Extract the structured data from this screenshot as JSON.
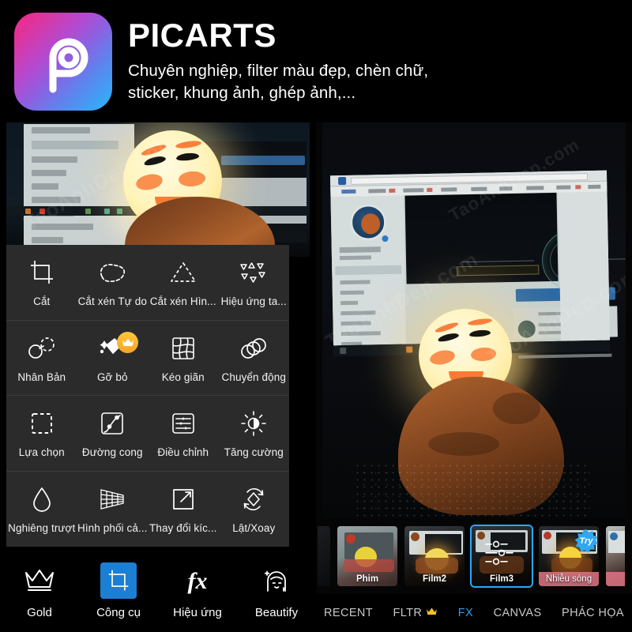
{
  "header": {
    "brand": "PICARTS",
    "tagline_line1": "Chuyên nghiệp, filter màu đẹp, chèn chữ,",
    "tagline_line2": "sticker, khung ảnh, ghép ảnh,...",
    "logo_icon": "picsart-logo-icon",
    "logo_gradient_start": "#f5268e",
    "logo_gradient_end": "#27b8fb"
  },
  "watermark": "TaoAnhDep.com",
  "tools_panel": {
    "rows": [
      [
        {
          "label": "Cắt",
          "icon": "crop-icon",
          "premium": false
        },
        {
          "label": "Cắt xén Tự do",
          "icon": "free-crop-icon",
          "premium": false
        },
        {
          "label": "Cắt xén Hìn...",
          "icon": "shape-crop-icon",
          "premium": false
        },
        {
          "label": "Hiệu ứng ta...",
          "icon": "dispersion-icon",
          "premium": false
        }
      ],
      [
        {
          "label": "Nhân Bản",
          "icon": "clone-icon",
          "premium": false
        },
        {
          "label": "Gỡ bỏ",
          "icon": "remove-icon",
          "premium": true
        },
        {
          "label": "Kéo giãn",
          "icon": "stretch-icon",
          "premium": false
        },
        {
          "label": "Chuyển động",
          "icon": "motion-icon",
          "premium": false
        }
      ],
      [
        {
          "label": "Lựa chọn",
          "icon": "selection-icon",
          "premium": false
        },
        {
          "label": "Đường cong",
          "icon": "curves-icon",
          "premium": false
        },
        {
          "label": "Điều chỉnh",
          "icon": "adjust-icon",
          "premium": false
        },
        {
          "label": "Tăng cường",
          "icon": "enhance-icon",
          "premium": false
        }
      ],
      [
        {
          "label": "Nghiêng trượt",
          "icon": "tilt-shift-icon",
          "premium": false
        },
        {
          "label": "Hình phối cả...",
          "icon": "perspective-icon",
          "premium": false
        },
        {
          "label": "Thay đổi kíc...",
          "icon": "resize-icon",
          "premium": false
        },
        {
          "label": "Lật/Xoay",
          "icon": "flip-rotate-icon",
          "premium": false
        }
      ]
    ],
    "premium_badge_icon": "crown-badge-icon",
    "premium_badge_color": "#f5a623"
  },
  "left_nav": {
    "items": [
      {
        "label": "Gold",
        "icon": "crown-icon",
        "active": false
      },
      {
        "label": "Công cụ",
        "icon": "tools-crop-icon",
        "active": true
      },
      {
        "label": "Hiệu ứng",
        "icon": "fx-icon",
        "active": false
      },
      {
        "label": "Beautify",
        "icon": "beautify-face-icon",
        "active": false
      }
    ],
    "active_color": "#1b7fd4"
  },
  "filter_strip": {
    "thumbnails": [
      {
        "label": "",
        "partial": "left",
        "selected": false,
        "badge": ""
      },
      {
        "label": "Phim",
        "partial": "",
        "selected": false,
        "badge": ""
      },
      {
        "label": "Film2",
        "partial": "",
        "selected": false,
        "badge": ""
      },
      {
        "label": "Film3",
        "partial": "",
        "selected": true,
        "badge": ""
      },
      {
        "label": "Nhiễu sóng",
        "partial": "",
        "selected": false,
        "badge": "Try"
      },
      {
        "label": "",
        "partial": "right",
        "selected": false,
        "badge": ""
      }
    ],
    "selection_color": "#29a8ff",
    "try_badge_color": "#2fa8ef"
  },
  "tab_bar": {
    "tabs": [
      {
        "label": "RECENT",
        "active": false,
        "crown": false
      },
      {
        "label": "FLTR",
        "active": false,
        "crown": true
      },
      {
        "label": "FX",
        "active": true,
        "crown": false
      },
      {
        "label": "CANVAS",
        "active": false,
        "crown": false
      },
      {
        "label": "PHÁC HỌA",
        "active": false,
        "crown": false
      }
    ],
    "active_color": "#2f9fe8",
    "crown_color": "#f0c02a"
  }
}
